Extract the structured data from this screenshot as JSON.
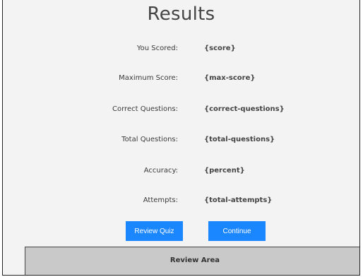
{
  "page": {
    "title": "Results"
  },
  "results": [
    {
      "label": "You Scored:",
      "value": "{score}"
    },
    {
      "label": "Maximum Score:",
      "value": "{max-score}"
    },
    {
      "label": "Correct Questions:",
      "value": "{correct-questions}"
    },
    {
      "label": "Total Questions:",
      "value": "{total-questions}"
    },
    {
      "label": "Accuracy:",
      "value": "{percent}"
    },
    {
      "label": "Attempts:",
      "value": "{total-attempts}"
    }
  ],
  "buttons": {
    "review_quiz": "Review Quiz",
    "continue": "Continue"
  },
  "review_area": {
    "label": "Review Area"
  },
  "colors": {
    "button": "#1a86ff",
    "review_area_bg": "#c9c9c9",
    "page_bg": "#f3f3f3"
  }
}
